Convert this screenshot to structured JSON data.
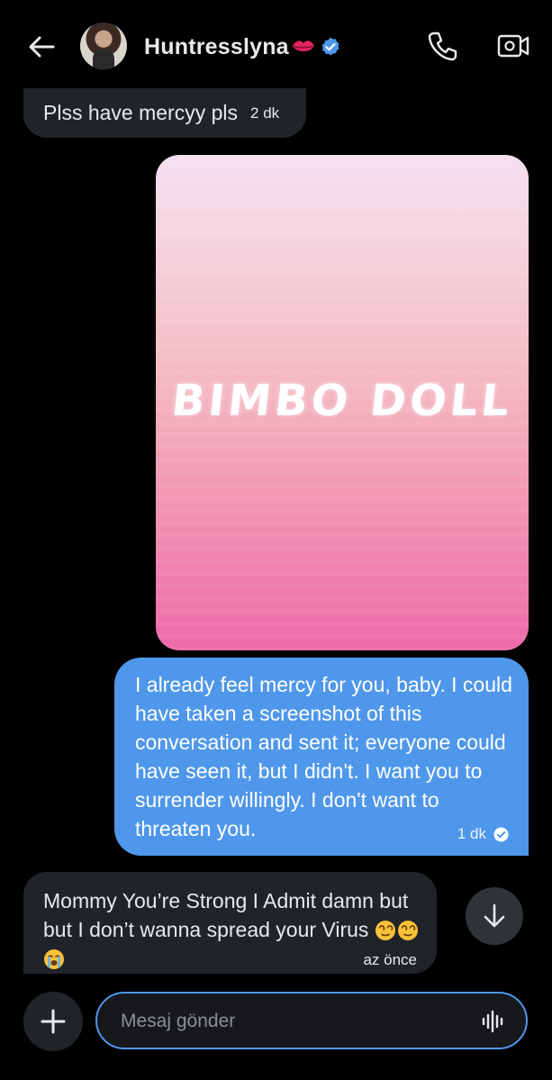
{
  "header": {
    "back_icon": "arrow-left-icon",
    "username": "Huntresslyna",
    "username_emoji": "kiss-mark-icon",
    "verified_icon": "verified-badge-icon",
    "call_icon": "phone-icon",
    "video_icon": "video-camera-icon",
    "accent_color": "#4f97ea"
  },
  "messages": [
    {
      "direction": "incoming",
      "text": "Plss have mercyy pls",
      "time": "2 dk"
    },
    {
      "direction": "outgoing",
      "type": "image",
      "image_text": "BIMBO DOLL",
      "gradient": [
        "#f6dff0",
        "#ee6aa8"
      ]
    },
    {
      "direction": "outgoing",
      "text": "I already feel mercy for you, baby. I could have taken a screenshot of this conversation and sent it; everyone could have seen it, but I didn't. I want you to surrender willingly. I don't want to threaten you.",
      "time": "1 dk",
      "status_icon": "read-check-icon",
      "bubble_color": "#4f97ea"
    },
    {
      "direction": "incoming",
      "text": "Mommy You’re Strong I Admit damn but but I don’t wanna spread your Virus",
      "emojis": [
        "dizzy-face-icon",
        "dizzy-face-icon",
        "loudly-crying-face-icon"
      ],
      "time": "az önce"
    }
  ],
  "scroll_down_icon": "arrow-down-icon",
  "composer": {
    "add_icon": "plus-icon",
    "placeholder": "Mesaj gönder",
    "value": "",
    "voice_icon": "voice-wave-icon"
  }
}
